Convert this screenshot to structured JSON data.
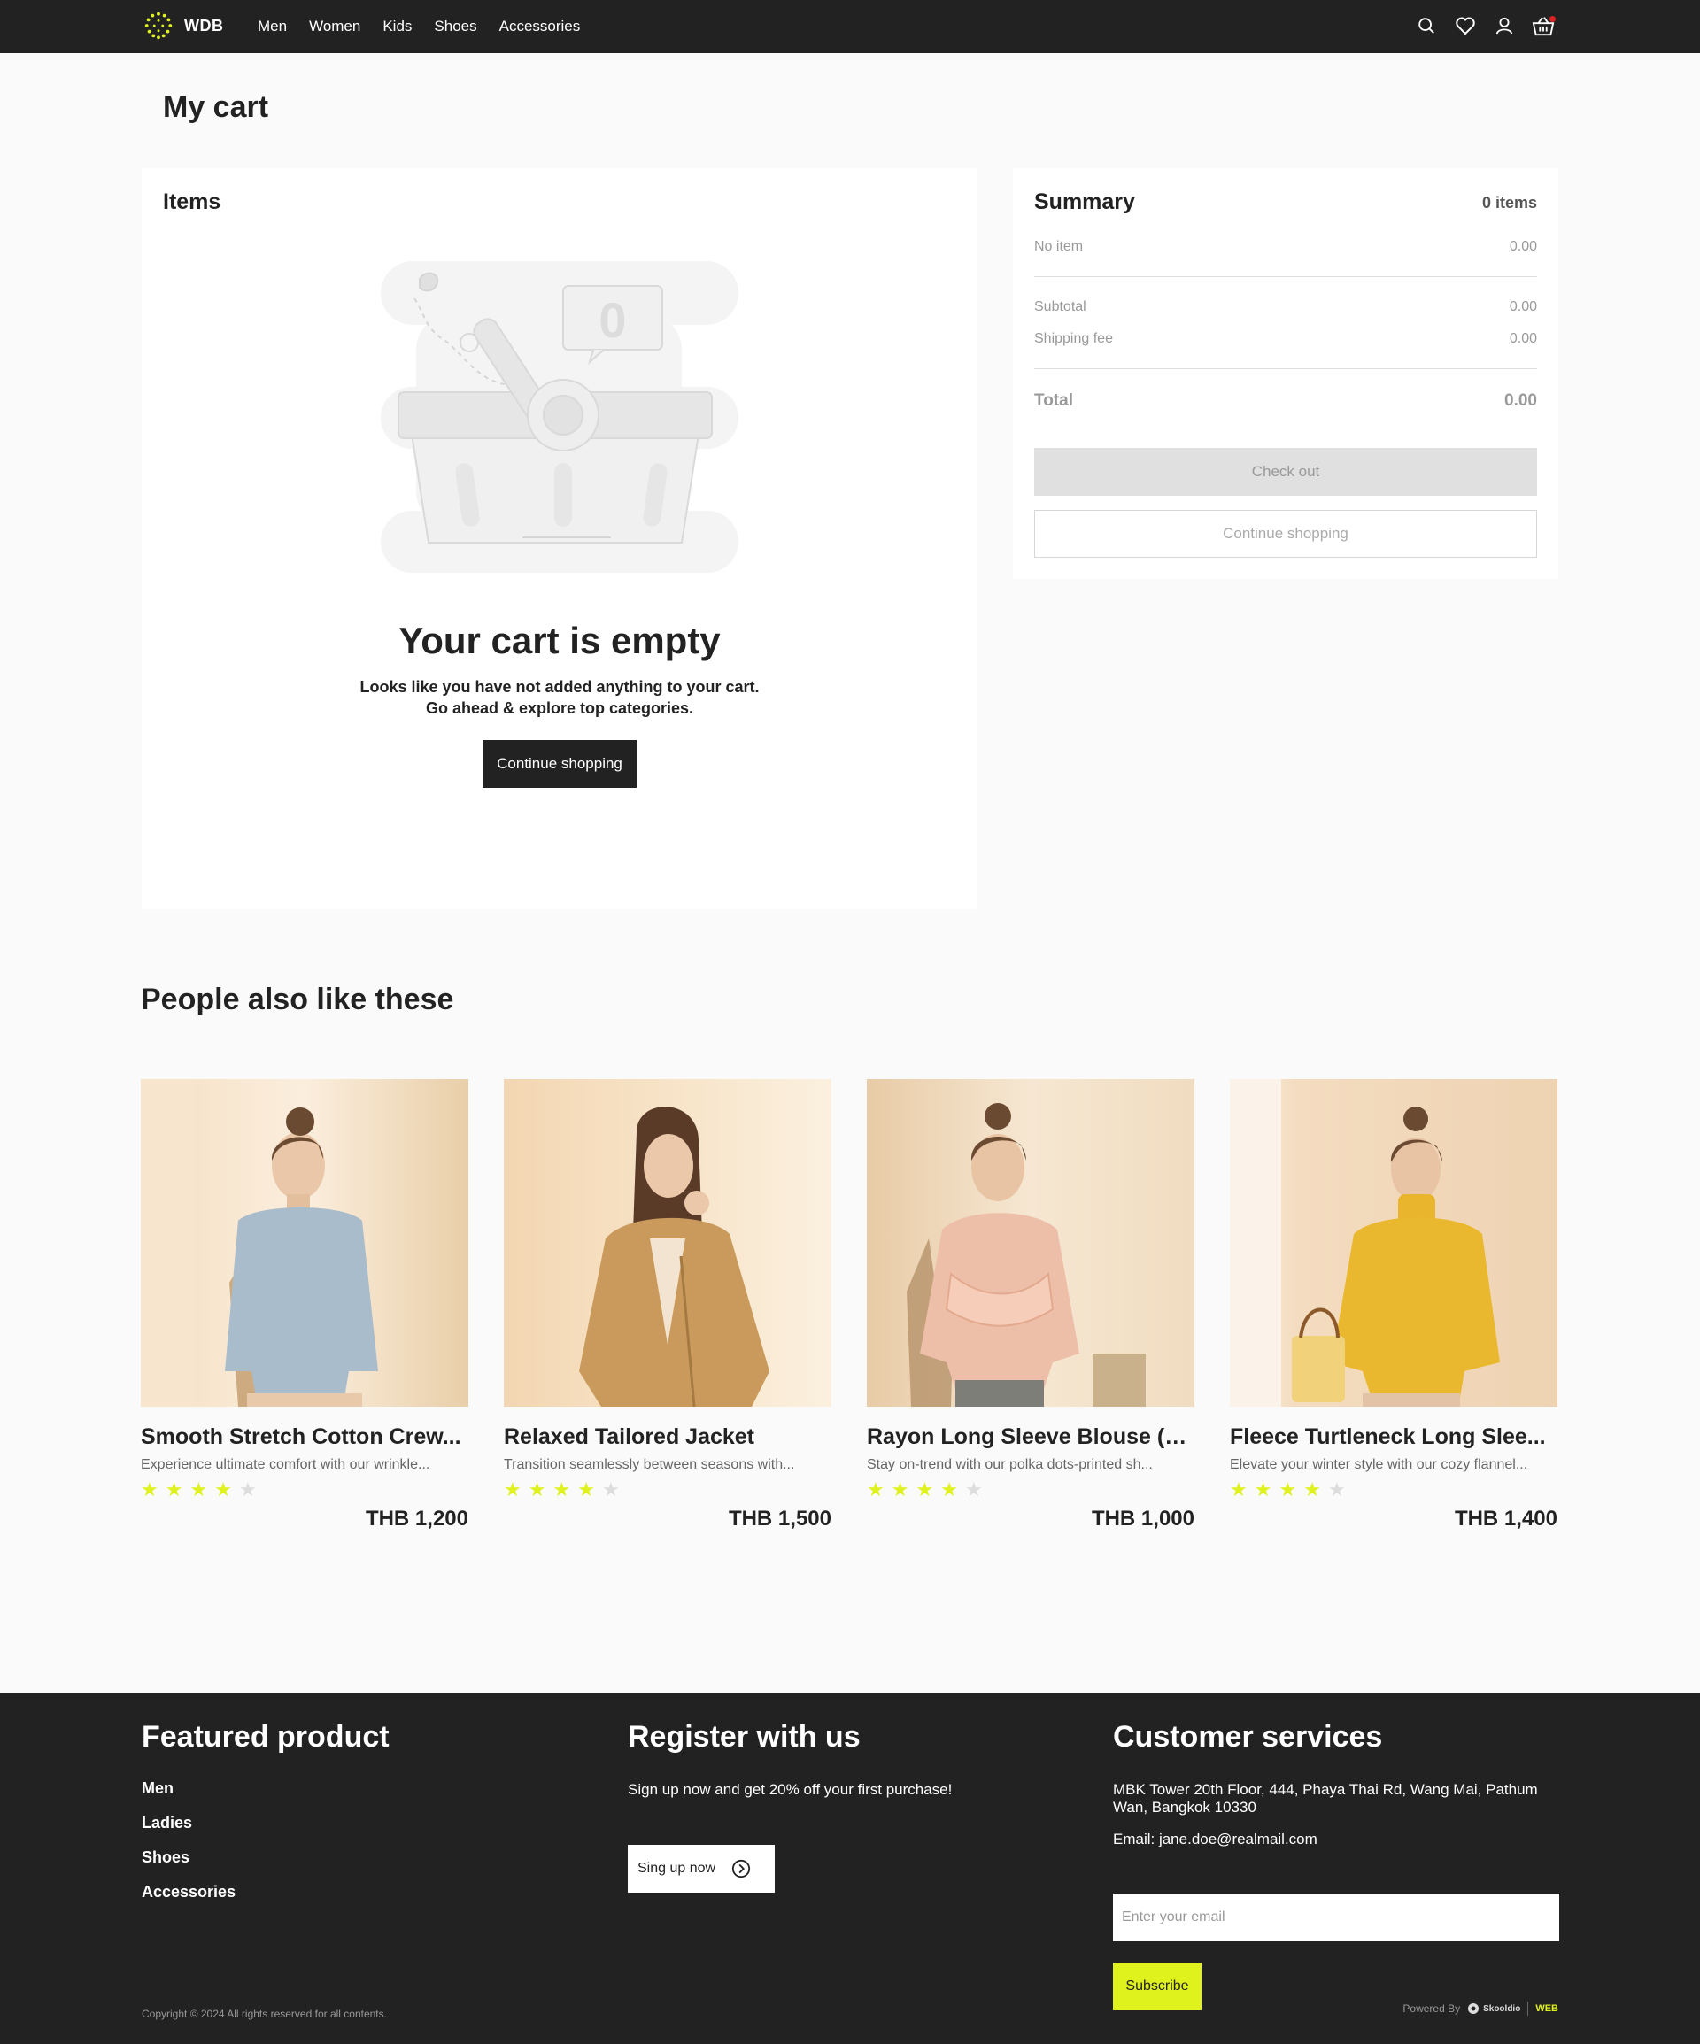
{
  "nav": {
    "brand": "WDB",
    "menu": [
      "Men",
      "Women",
      "Kids",
      "Shoes",
      "Accessories"
    ],
    "icons": [
      "search-icon",
      "heart-icon",
      "user-icon",
      "basket-icon"
    ]
  },
  "page": {
    "title": "My cart"
  },
  "items": {
    "title": "Items",
    "empty_badge": "0",
    "empty_title": "Your cart is  empty",
    "empty_line1": "Looks like you have not added anything to your cart.",
    "empty_line2": "Go ahead & explore top categories.",
    "continue_label": "Continue shopping"
  },
  "summary": {
    "title": "Summary",
    "count": "0 items",
    "no_item_label": "No item",
    "no_item_value": "0.00",
    "subtotal_label": "Subtotal",
    "subtotal_value": "0.00",
    "shipping_label": "Shipping fee",
    "shipping_value": "0.00",
    "total_label": "Total",
    "total_value": "0.00",
    "checkout_label": "Check out",
    "continue_label": "Continue shopping"
  },
  "recommendations": {
    "title": "People also like these",
    "products": [
      {
        "name": "Smooth Stretch Cotton Crew...",
        "desc": "Experience ultimate comfort with our wrinkle...",
        "rating": 4,
        "price": "THB 1,200"
      },
      {
        "name": "Relaxed Tailored Jacket",
        "desc": "Transition seamlessly between seasons with...",
        "rating": 4,
        "price": "THB 1,500"
      },
      {
        "name": "Rayon Long Sleeve Blouse (P...",
        "desc": "Stay on-trend with our polka dots-printed sh...",
        "rating": 4,
        "price": "THB 1,000"
      },
      {
        "name": "Fleece Turtleneck Long Slee...",
        "desc": "Elevate your winter style with our cozy flannel...",
        "rating": 4,
        "price": "THB 1,400"
      }
    ]
  },
  "footer": {
    "featured_title": "Featured product",
    "featured_links": [
      "Men",
      "Ladies",
      "Shoes",
      "Accessories"
    ],
    "register_title": "Register with us",
    "register_text": "Sign up now and get 20% off your first purchase!",
    "signup_label": "Sing up now",
    "service_title": "Customer services",
    "address": "MBK Tower 20th Floor, 444, Phaya Thai Rd, Wang Mai, Pathum Wan, Bangkok 10330",
    "email": "Email: jane.doe@realmail.com",
    "email_placeholder": "Enter your email",
    "subscribe_label": "Subscribe",
    "copyright": "Copyright © 2024 All rights reserved for all contents.",
    "powered_by": "Powered By",
    "brand_a": "Skooldio",
    "brand_b": "WEB"
  },
  "colors": {
    "dark": "#222222",
    "accent": "#dff21e",
    "star_off": "#dddddd",
    "muted": "#999999"
  }
}
